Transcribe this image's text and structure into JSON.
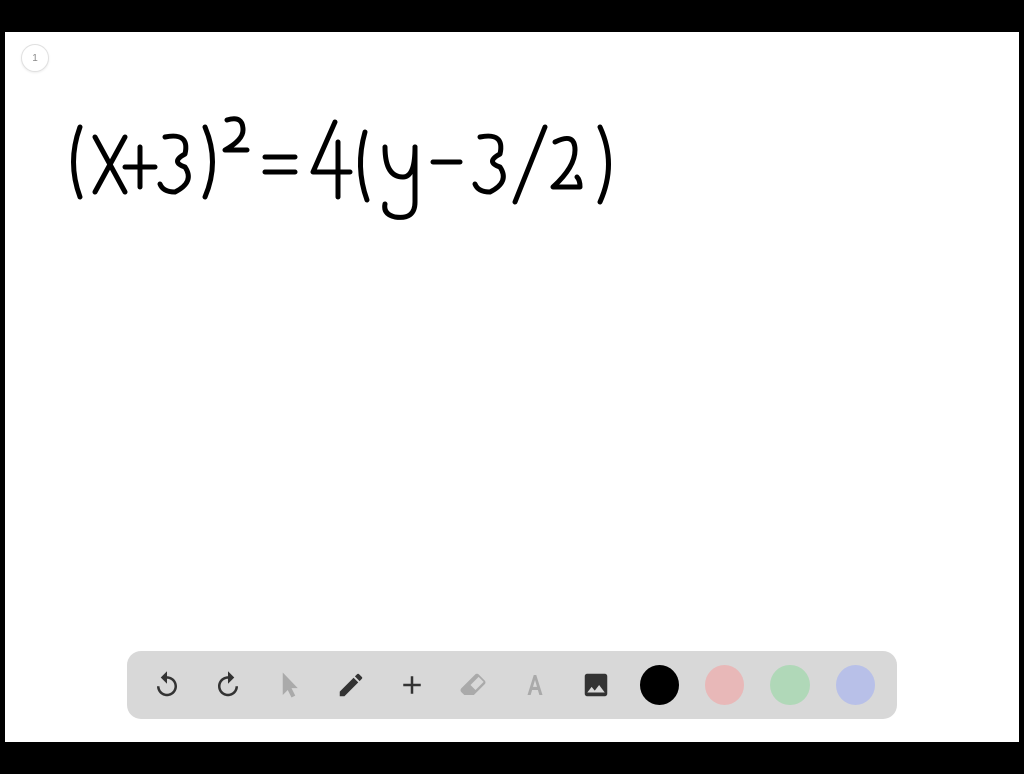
{
  "page": {
    "number": "1"
  },
  "handwriting": {
    "equation": "(x+3)² = 4(y - 3/2)"
  },
  "toolbar": {
    "undo": "Undo",
    "redo": "Redo",
    "pointer": "Pointer",
    "pen": "Pen",
    "add": "Add",
    "eraser": "Eraser",
    "text": "Text",
    "image": "Image"
  },
  "colors": {
    "black": "#000000",
    "pink": "#e8b8b8",
    "green": "#b0d8b8",
    "blue": "#b8c0e8"
  }
}
